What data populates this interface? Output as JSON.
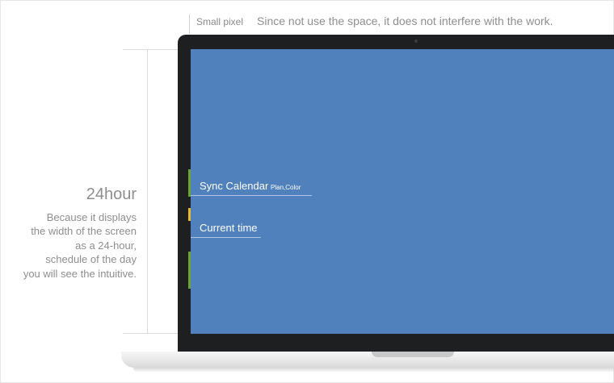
{
  "top_annotation": {
    "small_label": "Small pixel",
    "description": "Since not use the space, it does not interfere with the work."
  },
  "left_annotation": {
    "title": "24hour",
    "description": "Because it displays\nthe width of the screen\nas a 24-hour,\nschedule of the day\nyou will see the intuitive."
  },
  "callouts": {
    "sync_calendar": "Sync Calendar",
    "sync_subtitle": "Plan,Color",
    "current_time": "Current time"
  },
  "colors": {
    "screen": "#5181bc",
    "marker_green": "#6aa431",
    "marker_yellow": "#e8b92d",
    "bezel": "#1e1f21"
  }
}
